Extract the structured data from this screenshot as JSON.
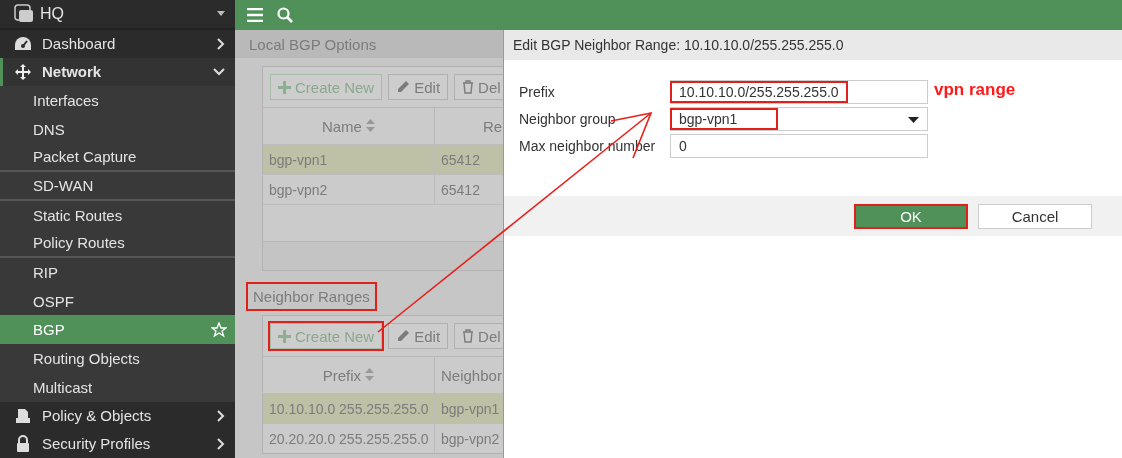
{
  "sidebar": {
    "device": "HQ",
    "items": [
      {
        "label": "Dashboard",
        "expanded": false
      },
      {
        "label": "Network",
        "expanded": true,
        "children": [
          {
            "label": "Interfaces",
            "selected": false,
            "divider_after": false
          },
          {
            "label": "DNS",
            "selected": false,
            "divider_after": false
          },
          {
            "label": "Packet Capture",
            "selected": false,
            "divider_after": true
          },
          {
            "label": "SD-WAN",
            "selected": false,
            "divider_after": true
          },
          {
            "label": "Static Routes",
            "selected": false,
            "divider_after": false
          },
          {
            "label": "Policy Routes",
            "selected": false,
            "divider_after": true
          },
          {
            "label": "RIP",
            "selected": false,
            "divider_after": false
          },
          {
            "label": "OSPF",
            "selected": false,
            "divider_after": false
          },
          {
            "label": "BGP",
            "selected": true,
            "divider_after": false
          },
          {
            "label": "Routing Objects",
            "selected": false,
            "divider_after": false
          },
          {
            "label": "Multicast",
            "selected": false,
            "divider_after": false
          }
        ]
      },
      {
        "label": "Policy & Objects",
        "expanded": false
      },
      {
        "label": "Security Profiles",
        "expanded": false
      }
    ]
  },
  "local_bgp": {
    "title": "Local BGP Options",
    "annotated": false,
    "toolbar": [
      {
        "kind": "create",
        "label": "Create New",
        "annotated": false
      },
      {
        "kind": "edit",
        "label": "Edit",
        "annotated": false
      },
      {
        "kind": "delete",
        "label": "Del",
        "annotated": false
      }
    ],
    "table": {
      "columns": [
        {
          "label": "Name",
          "sortable": true
        },
        {
          "label": "Re"
        }
      ],
      "rows": [
        {
          "cells": [
            "bgp-vpn1",
            "65412"
          ],
          "selected": true
        },
        {
          "cells": [
            "bgp-vpn2",
            "65412"
          ],
          "selected": false
        }
      ]
    }
  },
  "neighbor_ranges": {
    "title": "Neighbor Ranges",
    "annotated": true,
    "toolbar": [
      {
        "kind": "create",
        "label": "Create New",
        "annotated": true
      },
      {
        "kind": "edit",
        "label": "Edit",
        "annotated": false
      },
      {
        "kind": "delete",
        "label": "Del",
        "annotated": false
      }
    ],
    "table": {
      "columns": [
        {
          "label": "Prefix",
          "sortable": true
        },
        {
          "label": "Neighbor"
        }
      ],
      "rows": [
        {
          "cells": [
            "10.10.10.0 255.255.255.0",
            "bgp-vpn1"
          ],
          "selected": true
        },
        {
          "cells": [
            "20.20.20.0 255.255.255.0",
            "bgp-vpn2"
          ],
          "selected": false
        }
      ]
    }
  },
  "dialog": {
    "title": "Edit BGP Neighbor Range: 10.10.10.0/255.255.255.0",
    "fields": [
      {
        "kind": "text",
        "label": "Prefix",
        "value": "10.10.10.0/255.255.255.0",
        "annotated": true
      },
      {
        "kind": "select",
        "label": "Neighbor group",
        "value": "bgp-vpn1",
        "annotated": true
      },
      {
        "kind": "text",
        "label": "Max neighbor number",
        "value": "0",
        "annotated": false
      }
    ],
    "note": "vpn range",
    "buttons": [
      {
        "kind": "primary",
        "label": "OK",
        "annotated": true
      },
      {
        "kind": "secondary",
        "label": "Cancel",
        "annotated": false
      }
    ]
  }
}
